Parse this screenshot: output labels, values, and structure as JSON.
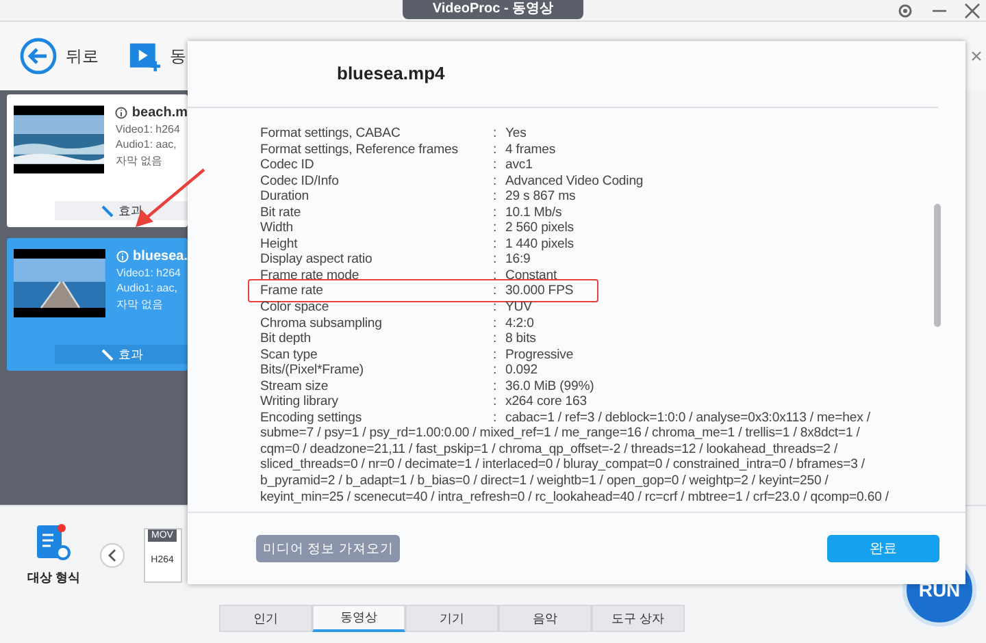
{
  "window": {
    "title": "VideoProc - 동영상"
  },
  "toolbar": [
    {
      "kind": "back",
      "label": "뒤로"
    },
    {
      "kind": "video",
      "label": "동"
    }
  ],
  "files": [
    {
      "name": "beach.m",
      "video": "Video1: h264",
      "audio": "Audio1: aac,",
      "subtitle": "자막 없음",
      "effect": "효과",
      "selected": false
    },
    {
      "name": "bluesea.",
      "video": "Video1: h264",
      "audio": "Audio1: aac,",
      "subtitle": "자막 없음",
      "effect": "효과",
      "selected": true
    }
  ],
  "target_format": {
    "label": "대상 형식",
    "format": "MOV",
    "codec": "H264"
  },
  "category_tabs": [
    {
      "label": "인기",
      "selected": false
    },
    {
      "label": "동영상",
      "selected": true
    },
    {
      "label": "기기",
      "selected": false
    },
    {
      "label": "음악",
      "selected": false
    },
    {
      "label": "도구 상자",
      "selected": false
    }
  ],
  "run_button": "RUN",
  "dialog": {
    "title": "bluesea.mp4",
    "rows": [
      {
        "label": "Format settings, CABAC",
        "sep": ":",
        "value": "Yes",
        "highlighted": false
      },
      {
        "label": "Format settings, Reference frames",
        "sep": ":",
        "value": "4 frames",
        "highlighted": false
      },
      {
        "label": "Codec ID",
        "sep": ":",
        "value": "avc1",
        "highlighted": false
      },
      {
        "label": "Codec ID/Info",
        "sep": ":",
        "value": "Advanced Video Coding",
        "highlighted": false
      },
      {
        "label": "Duration",
        "sep": ":",
        "value": "29 s 867 ms",
        "highlighted": false
      },
      {
        "label": "Bit rate",
        "sep": ":",
        "value": "10.1 Mb/s",
        "highlighted": false
      },
      {
        "label": "Width",
        "sep": ":",
        "value": "2 560 pixels",
        "highlighted": false
      },
      {
        "label": "Height",
        "sep": ":",
        "value": "1 440 pixels",
        "highlighted": false
      },
      {
        "label": "Display aspect ratio",
        "sep": ":",
        "value": "16:9",
        "highlighted": false
      },
      {
        "label": "Frame rate mode",
        "sep": ":",
        "value": "Constant",
        "highlighted": false
      },
      {
        "label": "Frame rate",
        "sep": ":",
        "value": "30.000 FPS",
        "highlighted": true
      },
      {
        "label": "Color space",
        "sep": ":",
        "value": "YUV",
        "highlighted": false
      },
      {
        "label": "Chroma subsampling",
        "sep": ":",
        "value": "4:2:0",
        "highlighted": false
      },
      {
        "label": "Bit depth",
        "sep": ":",
        "value": "8 bits",
        "highlighted": false
      },
      {
        "label": "Scan type",
        "sep": ":",
        "value": "Progressive",
        "highlighted": false
      },
      {
        "label": "Bits/(Pixel*Frame)",
        "sep": ":",
        "value": "0.092",
        "highlighted": false
      },
      {
        "label": "Stream size",
        "sep": ":",
        "value": "36.0 MiB (99%)",
        "highlighted": false
      },
      {
        "label": "Writing library",
        "sep": ":",
        "value": "x264 core 163",
        "highlighted": false
      },
      {
        "label": "Encoding settings",
        "sep": ":",
        "value": "cabac=1 / ref=3 / deblock=1:0:0 / analyse=0x3:0x113 / me=hex /",
        "highlighted": false,
        "continued": [
          "subme=7 / psy=1 / psy_rd=1.00:0.00 / mixed_ref=1 / me_range=16 / chroma_me=1 / trellis=1 / 8x8dct=1 /",
          "cqm=0 / deadzone=21,11 / fast_pskip=1 / chroma_qp_offset=-2 / threads=12 / lookahead_threads=2 /",
          "sliced_threads=0 / nr=0 / decimate=1 / interlaced=0 / bluray_compat=0 / constrained_intra=0 / bframes=3 /",
          "b_pyramid=2 / b_adapt=1 / b_bias=0 / direct=1 / weightb=1 / open_gop=0 / weightp=2 / keyint=250 /",
          "keyint_min=25 / scenecut=40 / intra_refresh=0 / rc_lookahead=40 / rc=crf / mbtree=1 / crf=23.0 / qcomp=0.60 /"
        ]
      }
    ],
    "buttons": [
      {
        "kind": "secondary",
        "label": "미디어 정보 가져오기"
      },
      {
        "kind": "primary",
        "label": "완료"
      }
    ]
  }
}
